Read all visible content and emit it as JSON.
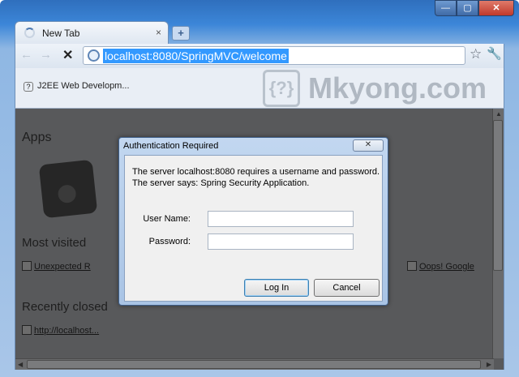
{
  "window": {
    "tab_title": "New Tab",
    "tab_close": "×",
    "new_tab": "+",
    "controls": {
      "minimize": "—",
      "maximize": "▢",
      "close": "✕"
    }
  },
  "toolbar": {
    "back": "←",
    "forward": "→",
    "stop": "✕",
    "url": "localhost:8080/SpringMVC/welcome",
    "star": "☆",
    "wrench": "🔧"
  },
  "bookmarks": {
    "items": [
      {
        "icon": "?",
        "label": "J2EE Web Developm..."
      }
    ]
  },
  "watermark": {
    "logo": "{?}",
    "text": "Mkyong.com"
  },
  "page": {
    "apps_heading": "Apps",
    "most_visited_heading": "Most visited",
    "most_visited": [
      "Unexpected R",
      "Oops! Google"
    ],
    "recently_closed_heading": "Recently closed",
    "recently_closed": [
      "http://localhost..."
    ]
  },
  "dialog": {
    "title": "Authentication Required",
    "close": "✕",
    "message_line1": "The server localhost:8080 requires a username and password.",
    "message_line2": "The server says: Spring Security Application.",
    "username_label": "User Name:",
    "username_value": "",
    "password_label": "Password:",
    "password_value": "",
    "login_button": "Log In",
    "cancel_button": "Cancel"
  }
}
